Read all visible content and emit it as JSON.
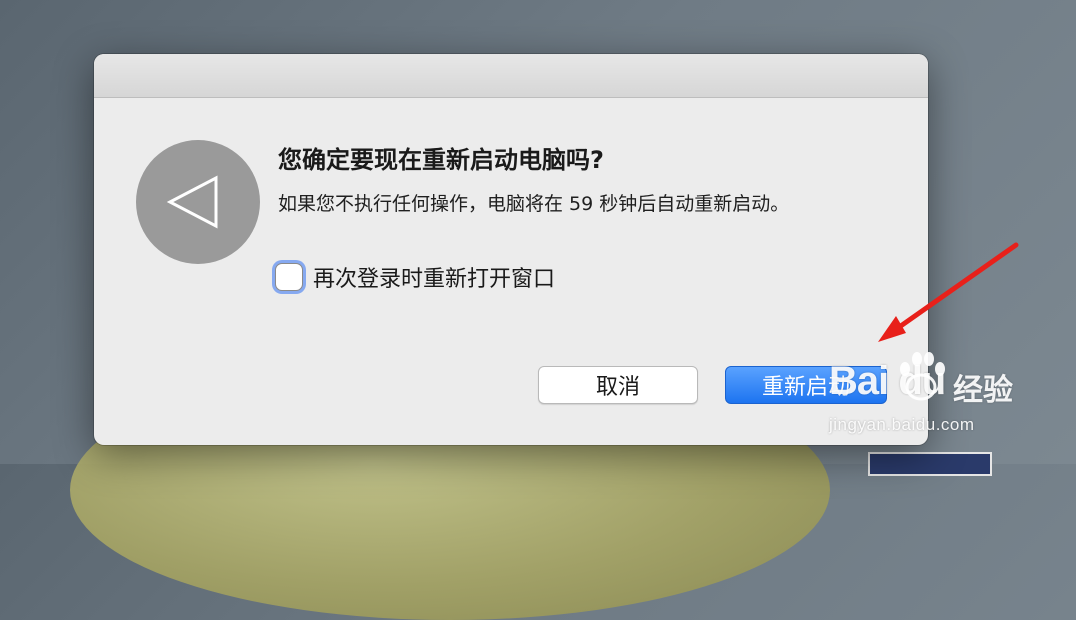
{
  "dialog": {
    "headline": "您确定要现在重新启动电脑吗?",
    "message": "如果您不执行任何操作，电脑将在 59 秒钟后自动重新启动。",
    "reopen_checkbox": {
      "label": "再次登录时重新打开窗口",
      "checked": false
    },
    "buttons": {
      "cancel": "取消",
      "restart": "重新启动"
    },
    "icon": "restart-back-icon"
  },
  "annotation": {
    "arrow_color": "#e8201a"
  },
  "watermark": {
    "logo": "Bai du",
    "product": "经验",
    "url": "jingyan.baidu.com"
  },
  "colors": {
    "accent": "#1d74f0",
    "dialog_bg": "#ececec"
  }
}
